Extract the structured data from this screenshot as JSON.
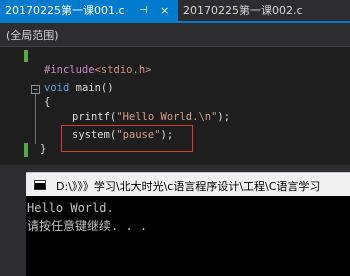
{
  "tabs": [
    {
      "label": "20170225第一课001.c",
      "active": true,
      "pin_glyph": "⊣",
      "close_glyph": "×"
    },
    {
      "label": "20170225第一课002.c",
      "active": false
    }
  ],
  "scope": {
    "label": "(全局范围)"
  },
  "code": {
    "include_directive": "#include",
    "include_header": "<stdio.h>",
    "fold_glyph": "−",
    "main_keyword": "void",
    "main_rest": " main()",
    "open_brace": "{",
    "printf_call": "printf(",
    "printf_string": "\"Hello World.\\n\"",
    "printf_end": ");",
    "system_call": "system(",
    "system_string": "\"pause\"",
    "system_end": ");",
    "close_brace": "}"
  },
  "console": {
    "title_path": "D:\\》》》学习\\北大时光\\c语言程序设计\\工程\\C语言学习",
    "output_lines": [
      "Hello World.",
      "请按任意键继续. . ."
    ]
  },
  "colors": {
    "tab_active": "#007acc",
    "ide_background": "#2d2d30",
    "editor_background": "#1e1e1e",
    "keyword": "#569cd6",
    "string": "#d69d85",
    "highlight_box": "#d83a3a",
    "change_marker": "#57a64a"
  }
}
